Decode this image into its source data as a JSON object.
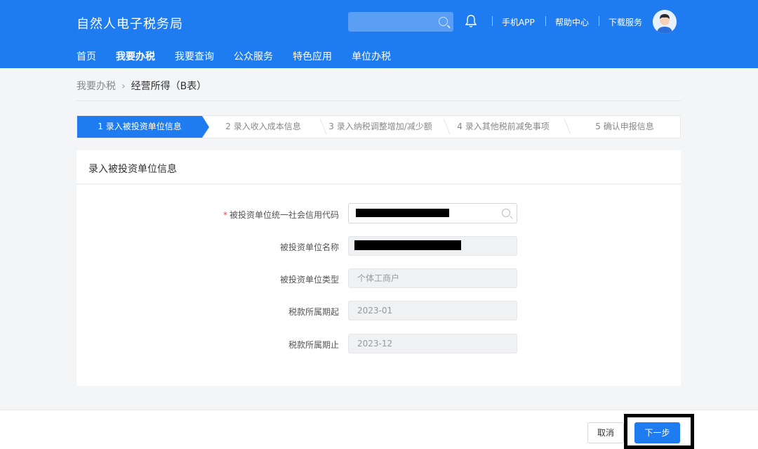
{
  "header": {
    "logo": "自然人电子税务局",
    "search_placeholder": "",
    "links": {
      "app": "手机APP",
      "help": "帮助中心",
      "download": "下载服务"
    }
  },
  "nav": [
    "首页",
    "我要办税",
    "我要查询",
    "公众服务",
    "特色应用",
    "单位办税"
  ],
  "breadcrumb": {
    "parent": "我要办税",
    "current": "经营所得（B表）"
  },
  "steps": [
    "1  录入被投资单位信息",
    "2  录入收入成本信息",
    "3  录入纳税调整增加/减少额",
    "4  录入其他税前减免事项",
    "5  确认申报信息"
  ],
  "panel": {
    "title": "录入被投资单位信息"
  },
  "form": {
    "credit_code_label": "被投资单位统一社会信用代码",
    "name_label": "被投资单位名称",
    "type_label": "被投资单位类型",
    "type_value": "个体工商户",
    "period_start_label": "税款所属期起",
    "period_start_value": "2023-01",
    "period_end_label": "税款所属期止",
    "period_end_value": "2023-12"
  },
  "footer": {
    "cancel": "取消",
    "next": "下一步"
  },
  "colors": {
    "primary": "#1f7cf0",
    "required": "#e54545"
  }
}
